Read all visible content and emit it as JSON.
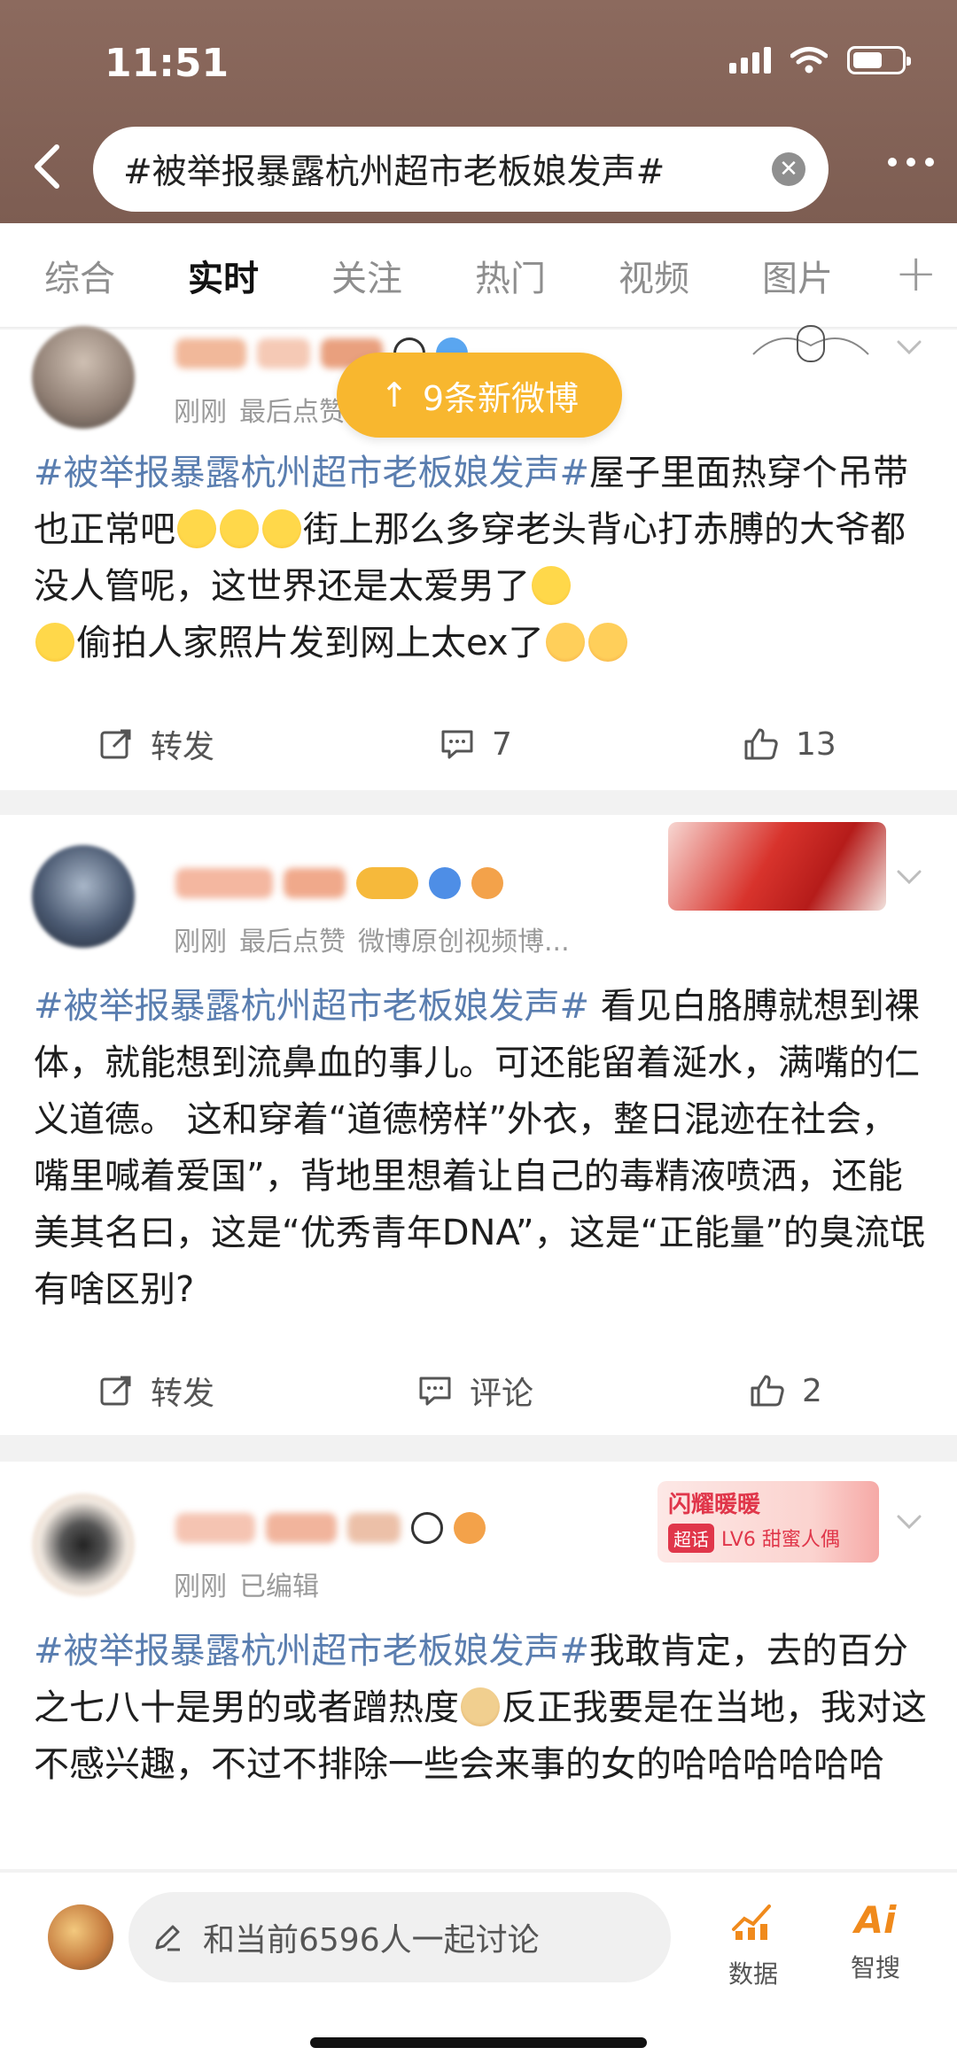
{
  "status_bar": {
    "time": "11:51"
  },
  "search": {
    "query": "#被举报暴露杭州超市老板娘发声#"
  },
  "tabs": [
    {
      "label": "综合"
    },
    {
      "label": "实时"
    },
    {
      "label": "关注"
    },
    {
      "label": "热门"
    },
    {
      "label": "视频"
    },
    {
      "label": "图片"
    }
  ],
  "tab_plus": "+",
  "new_posts_pill": "9条新微博",
  "posts": [
    {
      "meta": [
        "刚刚",
        "最后点赞"
      ],
      "topic": "#被举报暴露杭州超市老板娘发声#",
      "text_parts": [
        "屋子里面热穿个吊带也正常吧",
        "街上那么多穿老头背心打赤膊的大爷都没人管呢，这世界还是太爱男了",
        "偷拍人家照片发到网上太ex了"
      ],
      "actions": {
        "repost": "转发",
        "comment": "7",
        "like": "13"
      }
    },
    {
      "meta": [
        "刚刚",
        "最后点赞",
        "微博原创视频博..."
      ],
      "topic": "#被举报暴露杭州超市老板娘发声#",
      "text": " 看见白胳膊就想到裸体，就能想到流鼻血的事儿。可还能留着涎水，满嘴的仁义道德。 这和穿着“道德榜样”外衣，整日混迹在社会，嘴里喊着爱国”，背地里想着让自己的毒精液喷洒，还能美其名曰，这是“优秀青年DNA”，这是“正能量”的臭流氓有啥区别?",
      "actions": {
        "repost": "转发",
        "comment": "评论",
        "like": "2"
      }
    },
    {
      "meta": [
        "刚刚",
        "已编辑"
      ],
      "badge_title": "闪耀暖暖",
      "badge_sub": "超话",
      "badge_level": "LV6 甜蜜人偶",
      "topic": "#被举报暴露杭州超市老板娘发声#",
      "text_parts": [
        "我敢肯定，去的百分之七八十是男的或者蹭热度",
        "反正我要是在当地，我对这不感兴趣，不过不排除一些会来事的女的哈哈哈哈哈哈"
      ]
    }
  ],
  "bottom_bar": {
    "discuss_placeholder": "和当前6596人一起讨论",
    "data_label": "数据",
    "smart_label": "智搜"
  },
  "colors": {
    "topic": "#5a7eb0",
    "pill": "#f8b72f",
    "header": "#8c6a5e",
    "accent": "#f08a1c"
  }
}
